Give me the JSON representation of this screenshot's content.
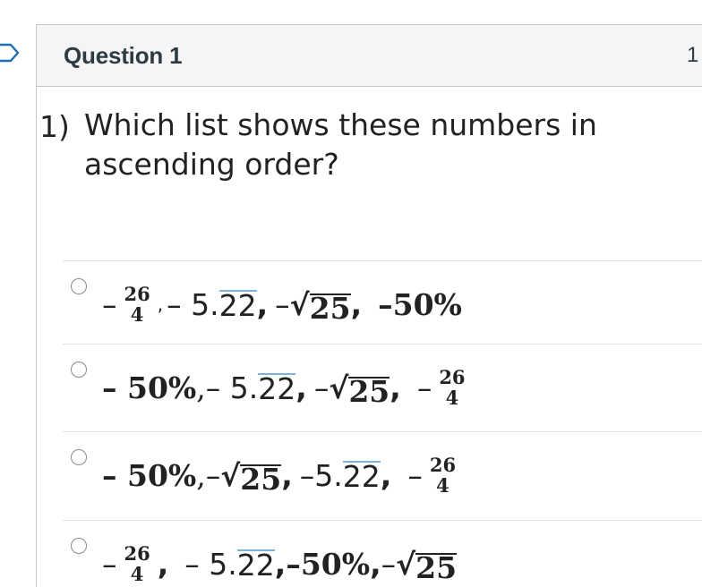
{
  "colors": {
    "header_bg": "#f5f5f5",
    "border": "#c7c7c7",
    "title_text": "#2d3b45",
    "repeat_bar": "#7db3d8",
    "flag_stroke": "#1f6fb2"
  },
  "question_card": {
    "title": "Question 1",
    "points": "1",
    "flag_icon": "flag-icon"
  },
  "question": {
    "number": "1)",
    "text": "Which list shows these numbers in ascending order?"
  },
  "answers": [
    {
      "parts": {
        "m1": "–",
        "f_num": "26",
        "f_den": "4",
        "c1": ",",
        "m2": "– 5.",
        "rep": "22",
        "c2": ",",
        "m3": "–",
        "rad_sym": "√",
        "rad_body": "25",
        "c3": ",",
        "pct": "–50%"
      }
    },
    {
      "parts": {
        "pct": "– 50%",
        "c1": ",",
        "m2": "– 5.",
        "rep": "22",
        "c2": ",",
        "m3": "–",
        "rad_sym": "√",
        "rad_body": "25",
        "c3": ",",
        "m4": "–",
        "f_num": "26",
        "f_den": "4"
      }
    },
    {
      "parts": {
        "pct": "– 50%",
        "c1": ",",
        "m3": "–",
        "rad_sym": "√",
        "rad_body": "25",
        "c2": ",",
        "m2": "–5.",
        "rep": "22",
        "c3": ",",
        "m4": "–",
        "f_num": "26",
        "f_den": "4"
      }
    },
    {
      "parts": {
        "m1": "–",
        "f_num": "26",
        "f_den": "4",
        "c1": ",",
        "m2": "– 5.",
        "rep": "22",
        "c2": ",",
        "pct": "–50%",
        "c3": ",",
        "m3": "–",
        "rad_sym": "√",
        "rad_body": "25"
      }
    }
  ]
}
